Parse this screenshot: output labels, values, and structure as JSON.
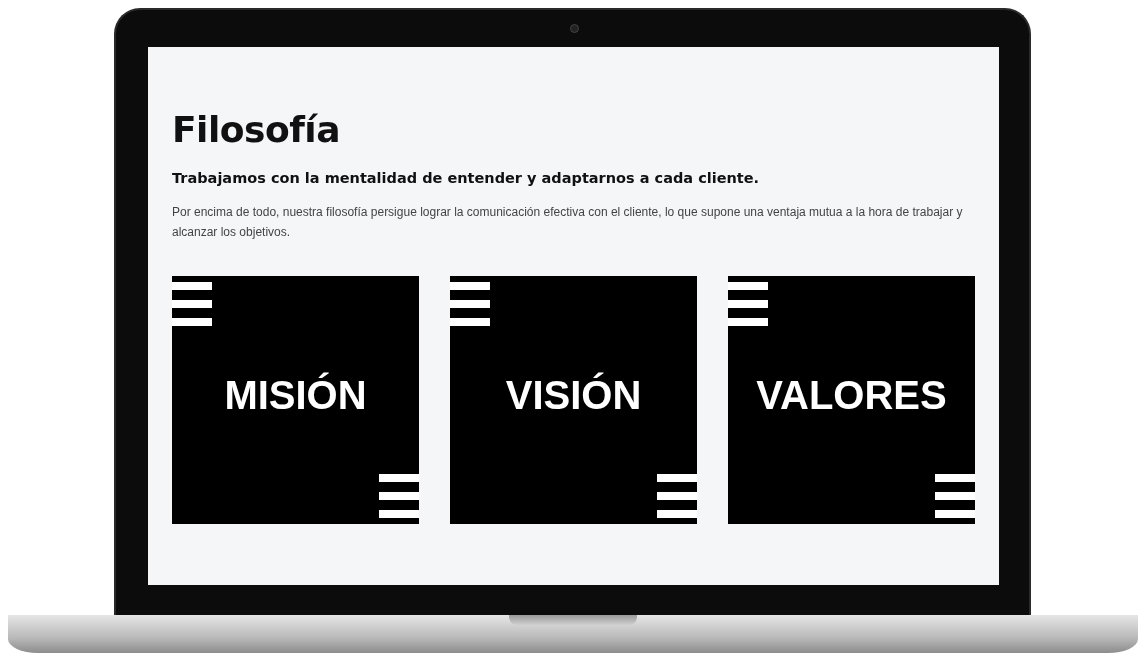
{
  "page": {
    "title": "Filosofía",
    "subtitle": "Trabajamos con la mentalidad de entender y adaptarnos a cada cliente.",
    "paragraph": "Por encima de todo, nuestra filosofía persigue lograr la comunicación efectiva con el cliente, lo que supone una ventaja mutua a la hora de trabajar y alcanzar los objetivos."
  },
  "cards": [
    {
      "title": "MISIÓN"
    },
    {
      "title": "VISIÓN"
    },
    {
      "title": "VALORES"
    }
  ]
}
